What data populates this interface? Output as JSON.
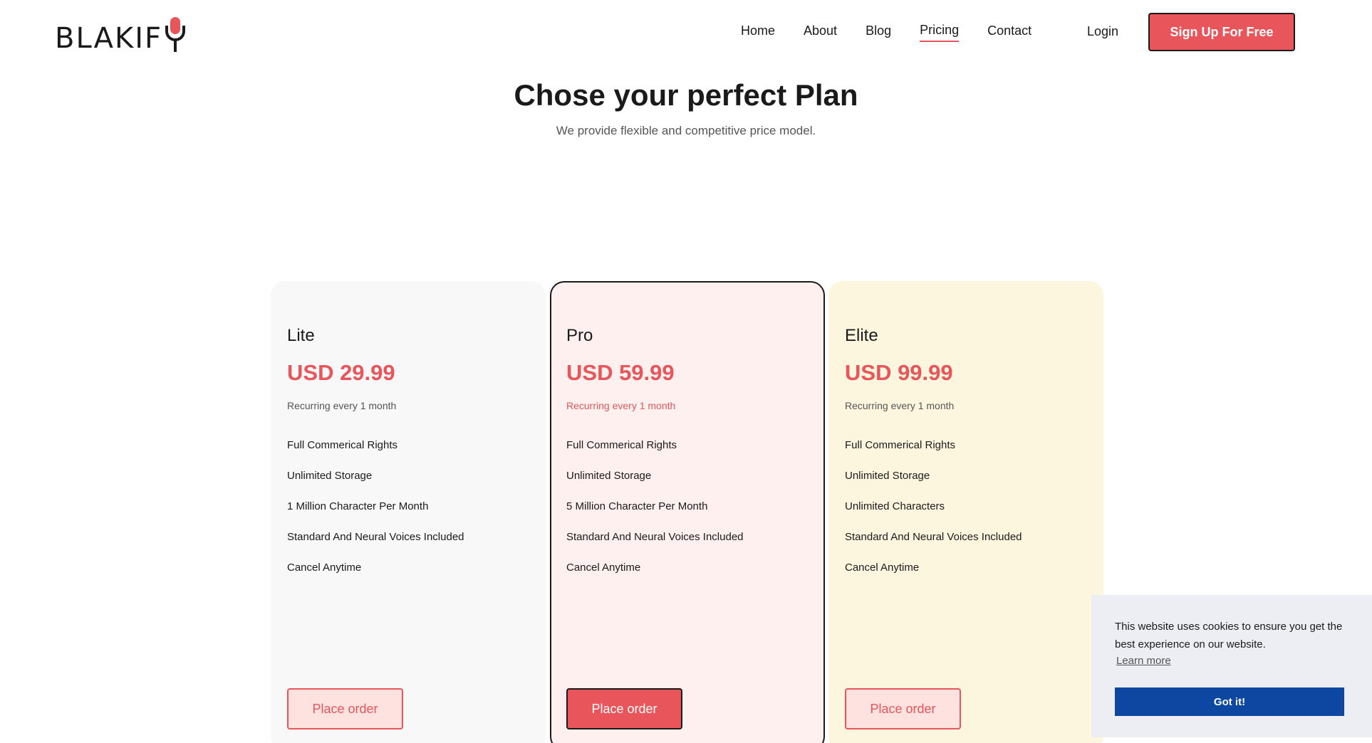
{
  "header": {
    "logo_text": "BLAKIF",
    "nav": [
      {
        "label": "Home"
      },
      {
        "label": "About"
      },
      {
        "label": "Blog"
      },
      {
        "label": "Pricing",
        "active": true
      },
      {
        "label": "Contact"
      }
    ],
    "login_label": "Login",
    "signup_label": "Sign Up For Free"
  },
  "hero": {
    "title": "Chose your perfect Plan",
    "subtitle": "We provide flexible and competitive price model."
  },
  "plans": [
    {
      "name": "Lite",
      "price": "USD 29.99",
      "recurring": "Recurring every 1 month",
      "features": [
        "Full Commerical Rights",
        "Unlimited Storage",
        "1 Million Character Per Month",
        "Standard And Neural Voices Included",
        "Cancel Anytime"
      ],
      "button": "Place order"
    },
    {
      "name": "Pro",
      "price": "USD 59.99",
      "recurring": "Recurring every 1 month",
      "features": [
        "Full Commerical Rights",
        "Unlimited Storage",
        "5 Million Character Per Month",
        "Standard And Neural Voices Included",
        "Cancel Anytime"
      ],
      "button": "Place order"
    },
    {
      "name": "Elite",
      "price": "USD 99.99",
      "recurring": "Recurring every 1 month",
      "features": [
        "Full Commerical Rights",
        "Unlimited Storage",
        "Unlimited Characters",
        "Standard And Neural Voices Included",
        "Cancel Anytime"
      ],
      "button": "Place order"
    }
  ],
  "cookie": {
    "text": "This website uses cookies to ensure you get the best experience on our website.",
    "learn_more": "Learn more",
    "accept": "Got it!"
  },
  "colors": {
    "accent": "#e8555a",
    "cookie_button": "#0d47a1"
  }
}
